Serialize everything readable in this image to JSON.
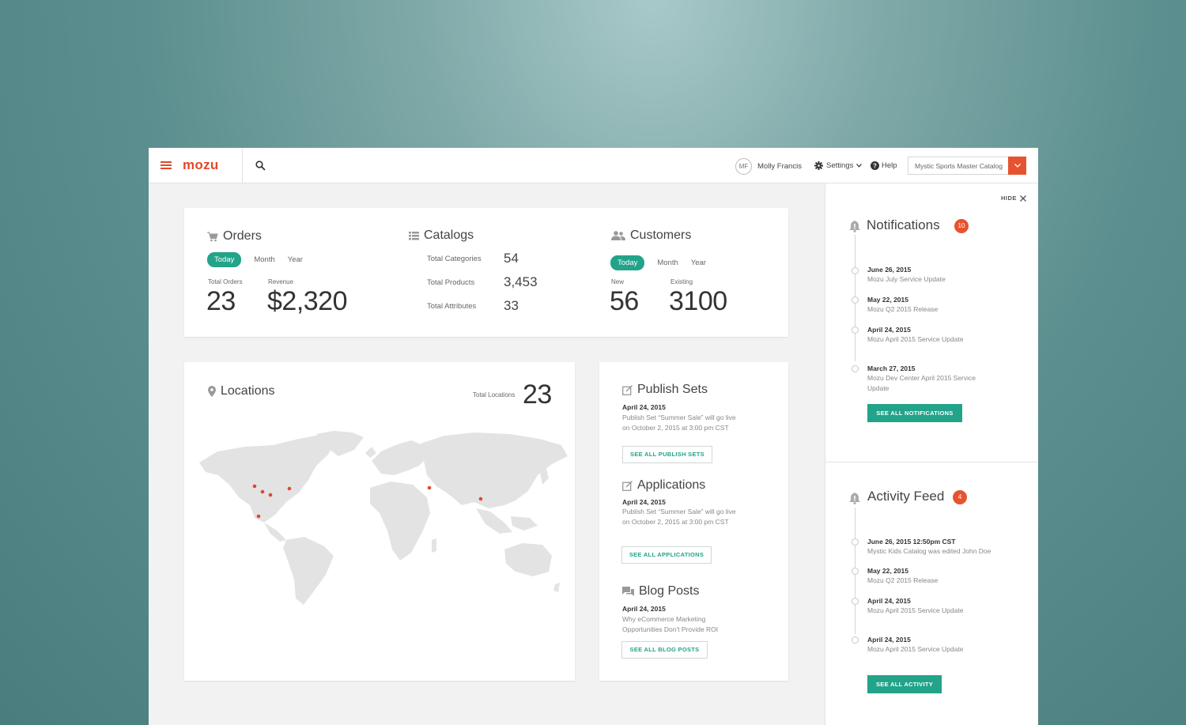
{
  "header": {
    "logo": "mozu",
    "user_initials": "MF",
    "user_name": "Molly Francis",
    "settings_label": "Settings",
    "help_label": "Help",
    "catalog": "Mystic Sports Master Catalog"
  },
  "orders": {
    "title": "Orders",
    "filters": [
      "Today",
      "Month",
      "Year"
    ],
    "total_orders_label": "Total Orders",
    "total_orders": "23",
    "revenue_label": "Revenue",
    "revenue": "$2,320"
  },
  "catalogs": {
    "title": "Catalogs",
    "rows": [
      {
        "label": "Total Categories",
        "value": "54"
      },
      {
        "label": "Total Products",
        "value": "3,453"
      },
      {
        "label": "Total Attributes",
        "value": "33"
      }
    ]
  },
  "customers": {
    "title": "Customers",
    "filters": [
      "Today",
      "Month",
      "Year"
    ],
    "new_label": "New",
    "new_value": "56",
    "existing_label": "Existing",
    "existing_value": "3100"
  },
  "locations": {
    "title": "Locations",
    "total_label": "Total Locations",
    "total": "23",
    "marker_color": "#e0492a"
  },
  "publish_sets": {
    "title": "Publish Sets",
    "date": "April 24, 2015",
    "desc_line1": "Publish Set “Summer Sale” will go live",
    "desc_line2": "on October 2, 2015 at 3:00 pm CST",
    "button": "SEE ALL PUBLISH SETS"
  },
  "applications": {
    "title": "Applications",
    "date": "April 24, 2015",
    "desc_line1": "Publish Set “Summer Sale” will go live",
    "desc_line2": "on October 2, 2015 at 3:00 pm CST",
    "button": "SEE ALL APPLICATIONS"
  },
  "blog_posts": {
    "title": "Blog Posts",
    "date": "April 24, 2015",
    "desc_line1": "Why eCommerce Marketing",
    "desc_line2": "Opportunities Don't Provide ROI",
    "button": "SEE ALL BLOG POSTS"
  },
  "notifications": {
    "hide_label": "HIDE",
    "title": "Notifications",
    "count": "10",
    "items": [
      {
        "date": "June 26, 2015",
        "text": "Mozu July Service Update"
      },
      {
        "date": "May 22, 2015",
        "text": "Mozu Q2 2015 Release"
      },
      {
        "date": "April 24, 2015",
        "text": "Mozu April 2015 Service Update"
      },
      {
        "date": "March 27, 2015",
        "text_line1": "Mozu Dev Center April 2015 Service",
        "text_line2": "Update"
      }
    ],
    "button": "SEE ALL NOTIFICATIONS"
  },
  "activity": {
    "title": "Activity Feed",
    "count": "4",
    "items": [
      {
        "date": "June 26, 2015  12:50pm CST",
        "text": "Mystic Kids Catalog was edited John Doe"
      },
      {
        "date": "May 22, 2015",
        "text": "Mozu Q2 2015 Release"
      },
      {
        "date": "April 24, 2015",
        "text": "Mozu April 2015 Service Update"
      },
      {
        "date": "April 24, 2015",
        "text": "Mozu April 2015 Service Update"
      }
    ],
    "button": "SEE ALL ACTIVITY"
  },
  "colors": {
    "brand": "#e0492a",
    "accent": "#22a38a",
    "badge": "#e8532f"
  }
}
